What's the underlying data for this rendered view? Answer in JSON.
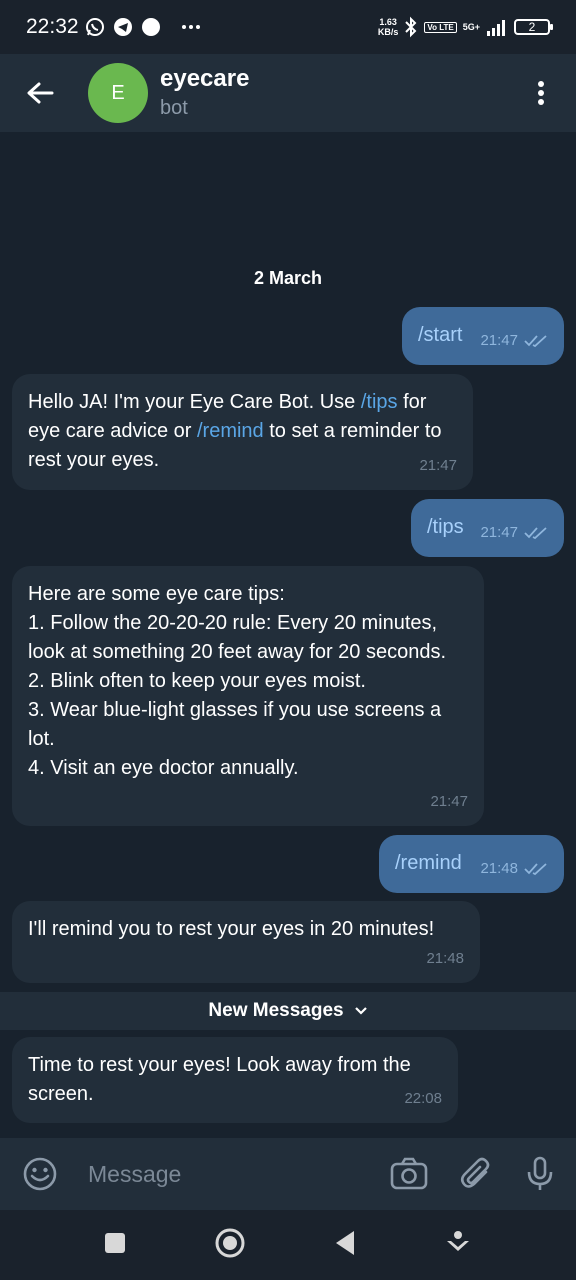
{
  "status_bar": {
    "time": "22:32",
    "net_speed_value": "1.63",
    "net_speed_unit": "KB/s",
    "volte": "Vo LTE",
    "network": "5G+",
    "battery": "2"
  },
  "header": {
    "avatar_letter": "E",
    "title": "eyecare",
    "subtitle": "bot",
    "avatar_color": "#6ab84f"
  },
  "chat": {
    "date_label": "2 March",
    "messages": [
      {
        "direction": "out",
        "text": "/start",
        "time": "21:47"
      },
      {
        "direction": "in",
        "text_parts": [
          "Hello JA! I'm your Eye Care Bot. Use ",
          "/tips",
          " for eye care advice or ",
          "/remind",
          " to set a reminder to rest your eyes."
        ],
        "time": "21:47"
      },
      {
        "direction": "out",
        "text": "/tips",
        "time": "21:47"
      },
      {
        "direction": "in",
        "text": "Here are some eye care tips:\n1. Follow the 20-20-20 rule: Every 20 minutes, look at something 20 feet away for 20 seconds.\n2. Blink often to keep your eyes moist.\n3. Wear blue-light glasses if you use screens a lot.\n4. Visit an eye doctor annually.",
        "time": "21:47"
      },
      {
        "direction": "out",
        "text": "/remind",
        "time": "21:48"
      },
      {
        "direction": "in",
        "text": "I'll remind you to rest your eyes in 20 minutes!",
        "time": "21:48"
      },
      {
        "direction": "in",
        "text": "Time to rest your eyes! Look away from the screen.",
        "time": "22:08"
      }
    ],
    "new_messages_label": "New Messages"
  },
  "input": {
    "placeholder": "Message"
  },
  "colors": {
    "background": "#18222d",
    "bubble_in": "#222e3a",
    "bubble_out": "#3f6a99",
    "link": "#5aa6e6"
  }
}
